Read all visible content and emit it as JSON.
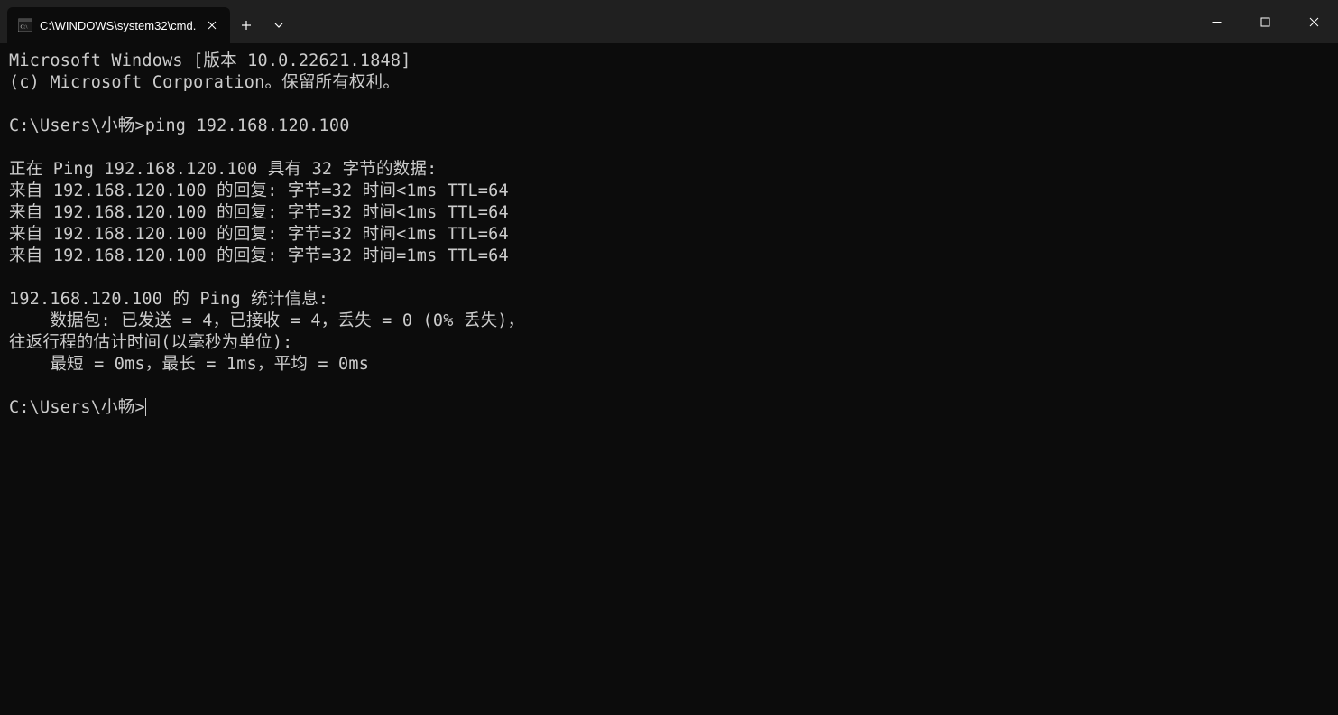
{
  "window": {
    "tab_title": "C:\\WINDOWS\\system32\\cmd."
  },
  "terminal": {
    "lines": [
      "Microsoft Windows [版本 10.0.22621.1848]",
      "(c) Microsoft Corporation。保留所有权利。",
      "",
      "C:\\Users\\小畅>ping 192.168.120.100",
      "",
      "正在 Ping 192.168.120.100 具有 32 字节的数据:",
      "来自 192.168.120.100 的回复: 字节=32 时间<1ms TTL=64",
      "来自 192.168.120.100 的回复: 字节=32 时间<1ms TTL=64",
      "来自 192.168.120.100 的回复: 字节=32 时间<1ms TTL=64",
      "来自 192.168.120.100 的回复: 字节=32 时间=1ms TTL=64",
      "",
      "192.168.120.100 的 Ping 统计信息:",
      "    数据包: 已发送 = 4，已接收 = 4，丢失 = 0 (0% 丢失)，",
      "往返行程的估计时间(以毫秒为单位):",
      "    最短 = 0ms，最长 = 1ms，平均 = 0ms",
      ""
    ],
    "prompt": "C:\\Users\\小畅>"
  }
}
